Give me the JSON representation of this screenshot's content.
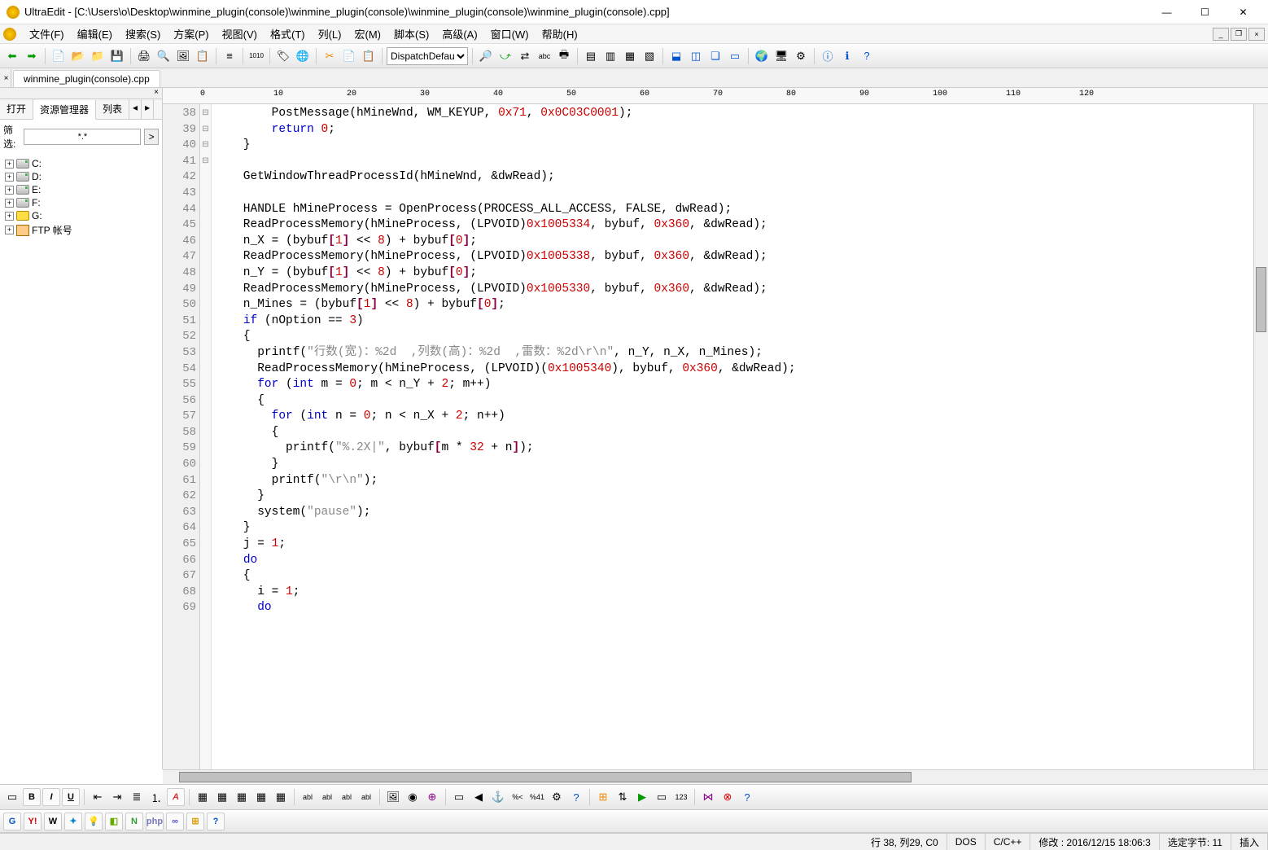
{
  "title": "UltraEdit - [C:\\Users\\o\\Desktop\\winmine_plugin(console)\\winmine_plugin(console)\\winmine_plugin(console)\\winmine_plugin(console).cpp]",
  "menus": [
    "文件(F)",
    "编辑(E)",
    "搜索(S)",
    "方案(P)",
    "视图(V)",
    "格式(T)",
    "列(L)",
    "宏(M)",
    "脚本(S)",
    "高级(A)",
    "窗口(W)",
    "帮助(H)"
  ],
  "toolbar_combo": "DispatchDefau",
  "tab_name": "winmine_plugin(console).cpp",
  "sidebar": {
    "tabs": [
      "打开",
      "资源管理器",
      "列表"
    ],
    "filter_label": "筛选:",
    "filter_value": "*.*",
    "tree": [
      {
        "label": "C:",
        "type": "drive"
      },
      {
        "label": "D:",
        "type": "drive"
      },
      {
        "label": "E:",
        "type": "drive"
      },
      {
        "label": "F:",
        "type": "drive"
      },
      {
        "label": "G:",
        "type": "usb"
      },
      {
        "label": "FTP 帐号",
        "type": "ftp"
      }
    ]
  },
  "ruler_ticks": [
    0,
    10,
    20,
    30,
    40,
    50,
    60,
    70,
    80,
    90,
    100,
    110,
    120
  ],
  "first_line": 38,
  "fold_marks": {
    "53": "⊟",
    "57": "⊟",
    "59": "⊟",
    "68": "⊟"
  },
  "code_lines": [
    "        PostMessage(hMineWnd, WM_KEYUP, <n>0x71</n>, <n>0x0C03C0001</n>);",
    "        <k>return</k> <n>0</n>;",
    "    }",
    "",
    "    GetWindowThreadProcessId(hMineWnd, &dwRead);",
    "",
    "    HANDLE hMineProcess = OpenProcess(PROCESS_ALL_ACCESS, FALSE, dwRead);",
    "    ReadProcessMemory(hMineProcess, (LPVOID)<n>0x1005334</n>, bybuf, <n>0x360</n>, &dwRead);",
    "    n_X = (bybuf<b>[</b><n>1</n><b>]</b> << <n>8</n>) + bybuf<b>[</b><n>0</n><b>]</b>;",
    "    ReadProcessMemory(hMineProcess, (LPVOID)<n>0x1005338</n>, bybuf, <n>0x360</n>, &dwRead);",
    "    n_Y = (bybuf<b>[</b><n>1</n><b>]</b> << <n>8</n>) + bybuf<b>[</b><n>0</n><b>]</b>;",
    "    ReadProcessMemory(hMineProcess, (LPVOID)<n>0x1005330</n>, bybuf, <n>0x360</n>, &dwRead);",
    "    n_Mines = (bybuf<b>[</b><n>1</n><b>]</b> << <n>8</n>) + bybuf<b>[</b><n>0</n><b>]</b>;",
    "    <k>if</k> (nOption == <n>3</n>)",
    "    {",
    "      printf(<s>\"行数(宽)：%2d  ,列数(高)：%2d  ,雷数：%2d\\r\\n\"</s>, n_Y, n_X, n_Mines);",
    "      ReadProcessMemory(hMineProcess, (LPVOID)(<n>0x1005340</n>), bybuf, <n>0x360</n>, &dwRead);",
    "      <k>for</k> (<k>int</k> m = <n>0</n>; m < n_Y + <n>2</n>; m++)",
    "      {",
    "        <k>for</k> (<k>int</k> n = <n>0</n>; n < n_X + <n>2</n>; n++)",
    "        {",
    "          printf(<s>\"%.2X|\"</s>, bybuf<b>[</b>m * <n>32</n> + n<b>]</b>);",
    "        }",
    "        printf(<s>\"\\r\\n\"</s>);",
    "      }",
    "      system(<s>\"pause\"</s>);",
    "    }",
    "    j = <n>1</n>;",
    "    <k>do</k>",
    "    {",
    "      i = <n>1</n>;",
    "      <k>do</k>"
  ],
  "status": {
    "pos": "行 38, 列29, C0",
    "enc": "DOS",
    "lang": "C/C++",
    "modified": "修改 : 2016/12/15 18:06:3",
    "sel": "选定字节: 11",
    "mode": "插入"
  },
  "bottom2_labels": [
    "G",
    "Y!",
    "W",
    "✦",
    "💡",
    "◧",
    "N",
    "php",
    "∞",
    "⊞",
    "?"
  ]
}
